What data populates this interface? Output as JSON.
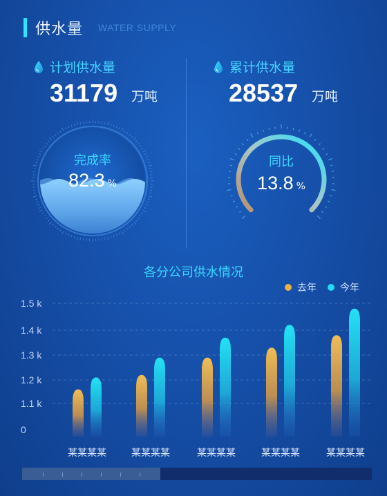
{
  "header": {
    "title": "供水量",
    "subtitle": "WATER SUPPLY"
  },
  "left_stat": {
    "label": "计划供水量",
    "value": "31179",
    "unit": "万吨",
    "icon": "water-drop-icon"
  },
  "right_stat": {
    "label": "累计供水量",
    "value": "28537",
    "unit": "万吨",
    "icon": "water-drop-icon"
  },
  "completion_gauge": {
    "label": "完成率",
    "value": "82.3",
    "unit": "%",
    "fill_fraction": 0.823
  },
  "yoy_gauge": {
    "label": "同比",
    "value": "13.8",
    "unit": "%"
  },
  "colors": {
    "accent": "#2ee6ff",
    "last_year": "#e8b24a",
    "this_year": "#26d8f0"
  },
  "chart_data": {
    "type": "bar",
    "title": "各分公司供水情况",
    "categories": [
      "某某某某",
      "某某某某",
      "某某某某",
      "某某某某",
      "某某某某"
    ],
    "series": [
      {
        "name": "去年",
        "values": [
          1160,
          1220,
          1290,
          1330,
          1380
        ]
      },
      {
        "name": "今年",
        "values": [
          1210,
          1290,
          1370,
          1420,
          1480
        ]
      }
    ],
    "y_ticks": [
      {
        "value": 1500,
        "label": "1.5 k"
      },
      {
        "value": 1400,
        "label": "1.4 k"
      },
      {
        "value": 1300,
        "label": "1.3 k"
      },
      {
        "value": 1200,
        "label": "1.2 k"
      },
      {
        "value": 1100,
        "label": "1.1 k"
      },
      {
        "value": 0,
        "label": "0"
      }
    ],
    "grid": true,
    "legend_position": "top-right"
  }
}
